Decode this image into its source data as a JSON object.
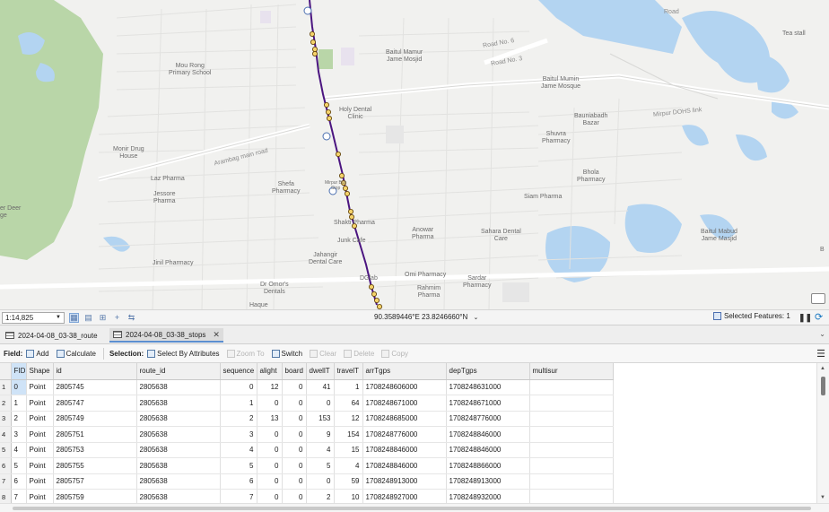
{
  "map": {
    "labels": [
      {
        "id": "tea-stall",
        "text": "Tea stall"
      },
      {
        "id": "baitul-mamur",
        "text": "Baitul Mamur\nJame Mosjid"
      },
      {
        "id": "mou-rong",
        "text": "Mou Rong\nPrimary School"
      },
      {
        "id": "baitul-mumin",
        "text": "Baitul Mumin\nJame Mosque"
      },
      {
        "id": "holy-dental",
        "text": "Holy Dental\nClinic"
      },
      {
        "id": "bauniabadh",
        "text": "Bauniabadh\nBazar"
      },
      {
        "id": "shuvra",
        "text": "Shuvra\nPharmacy"
      },
      {
        "id": "monir-drug",
        "text": "Monir Drug\nHouse"
      },
      {
        "id": "bhola",
        "text": "Bhola\nPharmacy"
      },
      {
        "id": "laz",
        "text": "Laz Pharma"
      },
      {
        "id": "shefa",
        "text": "Shefa\nPharmacy"
      },
      {
        "id": "mirpur-bus",
        "text": "Mirpur Bus\nStop"
      },
      {
        "id": "siam",
        "text": "Siam Pharma"
      },
      {
        "id": "jessore",
        "text": "Jessore\nPharma"
      },
      {
        "id": "deer",
        "text": "er Deer\nge"
      },
      {
        "id": "shakti",
        "text": "Shakti Pharma"
      },
      {
        "id": "anowar",
        "text": "Anowar\nPharma"
      },
      {
        "id": "sahara",
        "text": "Sahara Dental\nCare"
      },
      {
        "id": "baitul-mabud",
        "text": "Baitul Mabud\nJame Masjid"
      },
      {
        "id": "junk-cafe",
        "text": "Junk Cafe"
      },
      {
        "id": "jahangir",
        "text": "Jahangir\nDental Care"
      },
      {
        "id": "jinil",
        "text": "Jinil Pharmacy"
      },
      {
        "id": "omi",
        "text": "Omi Pharmacy"
      },
      {
        "id": "sardar",
        "text": "Sardar\nPharmacy"
      },
      {
        "id": "dr-omor",
        "text": "Dr Omor's\nDentals"
      },
      {
        "id": "dglab",
        "text": "DGlab"
      },
      {
        "id": "rahmim",
        "text": "Rahmim\nPharma"
      },
      {
        "id": "haque",
        "text": "Haque"
      },
      {
        "id": "edge-b",
        "text": "B"
      }
    ],
    "roads": [
      {
        "id": "road-no-6",
        "text": "Road No. 6"
      },
      {
        "id": "road-no-3",
        "text": "Road No. 3"
      },
      {
        "id": "arambag",
        "text": "Arambag main road"
      },
      {
        "id": "mirpur-dohs",
        "text": "Mirpur DOHS link"
      },
      {
        "id": "top-road",
        "text": "Road"
      }
    ]
  },
  "statusbar": {
    "scale": "1:14,825",
    "coordinates": "90.3589446°E 23.8246660°N",
    "selected_features": "Selected Features: 1"
  },
  "tabs": [
    {
      "label": "2024-04-08_03-38_route",
      "active": false
    },
    {
      "label": "2024-04-08_03-38_stops",
      "active": true
    }
  ],
  "toolbar": {
    "field_label": "Field:",
    "add": "Add",
    "calculate": "Calculate",
    "selection_label": "Selection:",
    "select_by_attributes": "Select By Attributes",
    "zoom_to": "Zoom To",
    "switch": "Switch",
    "clear": "Clear",
    "delete": "Delete",
    "copy": "Copy"
  },
  "table": {
    "columns": [
      "FID",
      "Shape",
      "id",
      "route_id",
      "sequence",
      "alight",
      "board",
      "dwellT",
      "travelT",
      "arrTgps",
      "depTgps",
      "multisur"
    ],
    "rows": [
      [
        "1",
        "0",
        "Point",
        "2805745",
        "2805638",
        "0",
        "12",
        "0",
        "41",
        "1",
        "1708248606000",
        "1708248631000",
        ""
      ],
      [
        "2",
        "1",
        "Point",
        "2805747",
        "2805638",
        "1",
        "0",
        "0",
        "0",
        "64",
        "1708248671000",
        "1708248671000",
        ""
      ],
      [
        "3",
        "2",
        "Point",
        "2805749",
        "2805638",
        "2",
        "13",
        "0",
        "153",
        "12",
        "1708248685000",
        "1708248776000",
        ""
      ],
      [
        "4",
        "3",
        "Point",
        "2805751",
        "2805638",
        "3",
        "0",
        "0",
        "9",
        "154",
        "1708248776000",
        "1708248846000",
        ""
      ],
      [
        "5",
        "4",
        "Point",
        "2805753",
        "2805638",
        "4",
        "0",
        "0",
        "4",
        "15",
        "1708248846000",
        "1708248846000",
        ""
      ],
      [
        "6",
        "5",
        "Point",
        "2805755",
        "2805638",
        "5",
        "0",
        "0",
        "5",
        "4",
        "1708248846000",
        "1708248866000",
        ""
      ],
      [
        "7",
        "6",
        "Point",
        "2805757",
        "2805638",
        "6",
        "0",
        "0",
        "0",
        "59",
        "1708248913000",
        "1708248913000",
        ""
      ],
      [
        "8",
        "7",
        "Point",
        "2805759",
        "2805638",
        "7",
        "0",
        "0",
        "2",
        "10",
        "1708248927000",
        "1708248932000",
        ""
      ]
    ]
  },
  "colors": {
    "route": "#4b1580",
    "stop_fill": "#f5d36b",
    "water": "#b3d4f1",
    "park": "#b9d6a8",
    "selection": "#cfe3f7"
  }
}
